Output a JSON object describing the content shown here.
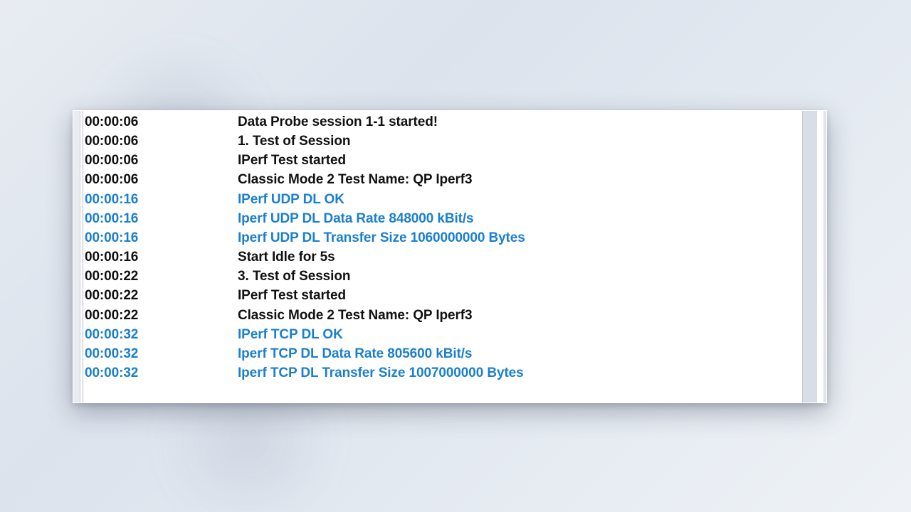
{
  "colors": {
    "link": "#1a7fcf",
    "text": "#111111",
    "panel_bg": "#ffffff",
    "page_bg": "#e8ecf2"
  },
  "log": {
    "rows": [
      {
        "time": "00:00:06",
        "msg": "Data Probe session 1-1 started!",
        "link": false
      },
      {
        "time": "00:00:06",
        "msg": "1. Test of Session",
        "link": false
      },
      {
        "time": "00:00:06",
        "msg": "IPerf Test started",
        "link": false
      },
      {
        "time": "00:00:06",
        "msg": "Classic Mode 2 Test Name: QP Iperf3",
        "link": false
      },
      {
        "time": "00:00:16",
        "msg": "IPerf UDP DL OK",
        "link": true
      },
      {
        "time": "00:00:16",
        "msg": "Iperf UDP DL Data Rate 848000 kBit/s",
        "link": true
      },
      {
        "time": "00:00:16",
        "msg": "Iperf UDP DL Transfer Size 1060000000 Bytes",
        "link": true
      },
      {
        "time": "00:00:16",
        "msg": "Start Idle for 5s",
        "link": false
      },
      {
        "time": "00:00:22",
        "msg": "3. Test of Session",
        "link": false
      },
      {
        "time": "00:00:22",
        "msg": "IPerf Test started",
        "link": false
      },
      {
        "time": "00:00:22",
        "msg": "Classic Mode 2 Test Name: QP Iperf3",
        "link": false
      },
      {
        "time": "00:00:32",
        "msg": "IPerf TCP DL OK",
        "link": true
      },
      {
        "time": "00:00:32",
        "msg": "Iperf TCP DL Data Rate 805600 kBit/s",
        "link": true
      },
      {
        "time": "00:00:32",
        "msg": "Iperf TCP DL Transfer Size 1007000000 Bytes",
        "link": true
      }
    ]
  }
}
